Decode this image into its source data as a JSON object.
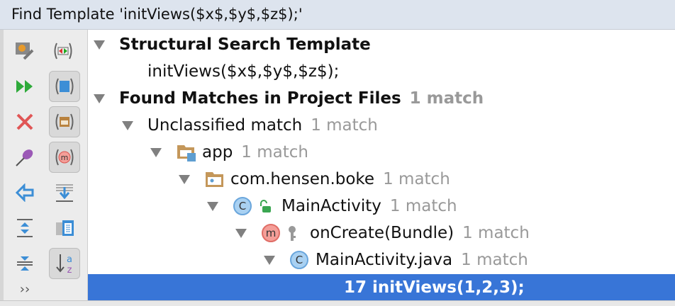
{
  "title": "Find Template 'initViews($x$,$y$,$z$);'",
  "toolbar": [
    {
      "name": "settings-icon"
    },
    {
      "name": "preview-usages-icon"
    },
    {
      "name": "rerun-icon"
    },
    {
      "name": "group-by-module-icon",
      "pressed": true
    },
    {
      "name": "close-icon"
    },
    {
      "name": "group-by-package-icon",
      "pressed": true
    },
    {
      "name": "pin-icon"
    },
    {
      "name": "group-by-file-structure-icon",
      "pressed": true
    },
    {
      "name": "previous-icon"
    },
    {
      "name": "merge-dup-lines-icon"
    },
    {
      "name": "expand-all-icon"
    },
    {
      "name": "preview-icon"
    },
    {
      "name": "collapse-all-icon"
    },
    {
      "name": "sort-alphabetically-icon",
      "pressed": true
    },
    {
      "name": "more-icon",
      "label": "››"
    }
  ],
  "tree": [
    {
      "label": "Structural Search Template",
      "bold": true,
      "count": ""
    },
    {
      "label": "initViews($x$,$y$,$z$);",
      "count": ""
    },
    {
      "label": "Found Matches in Project Files",
      "bold": true,
      "count": "1 match"
    },
    {
      "label": "Unclassified match",
      "count": "1 match"
    },
    {
      "label": "app",
      "count": "1 match",
      "icon": "module-folder-icon"
    },
    {
      "label": "com.hensen.boke",
      "count": "1 match",
      "icon": "package-icon"
    },
    {
      "label": "MainActivity",
      "count": "1 match",
      "icon": "class-icon",
      "icon_text": "C"
    },
    {
      "label": "onCreate(Bundle)",
      "count": "1 match",
      "icon": "method-icon",
      "icon_text": "m"
    },
    {
      "label": "MainActivity.java",
      "count": "1 match",
      "icon": "class-icon",
      "icon_text": "C"
    },
    {
      "label": "17 initViews(1,2,3);",
      "count": "",
      "selected": true
    }
  ],
  "colors": {
    "selection": "#3875d7",
    "count": "#999999"
  }
}
